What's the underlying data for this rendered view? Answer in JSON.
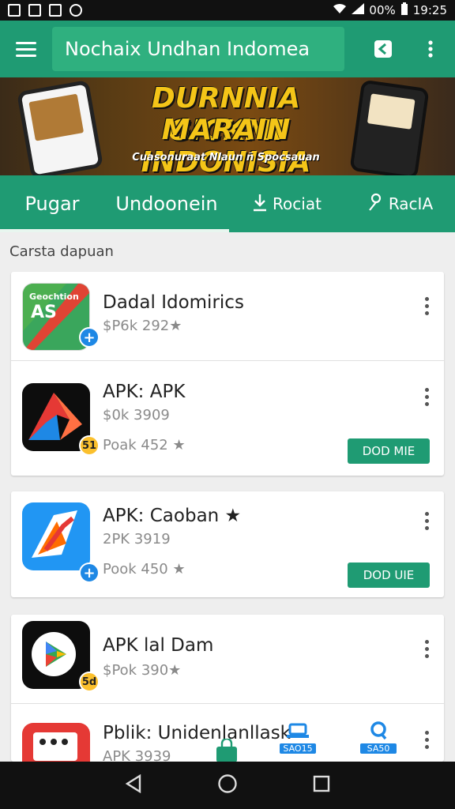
{
  "status_bar": {
    "battery": "00%",
    "time": "19:25"
  },
  "app_bar": {
    "search_text": "Nochaix Undhan Indomea"
  },
  "banner": {
    "line1": "DURNNIA GICKMI",
    "line2": "MARAIN INDONISIA",
    "tagline": "Cuasonuraat Nlaun ñ Spocsauan"
  },
  "tabs": [
    {
      "label": "Pugar"
    },
    {
      "label": "Undoonein"
    },
    {
      "label": "Rociat",
      "icon": "download-icon"
    },
    {
      "label": "RacIA",
      "icon": "person-icon"
    }
  ],
  "section": {
    "title": "Carsta dapuan"
  },
  "apps": [
    {
      "name": "Dadal Idomirics",
      "sub1": "$P6k 292★",
      "sub2": "",
      "button": "",
      "icon_label": "Geochtion\nAS",
      "badge": "+"
    },
    {
      "name": "APK: APK",
      "sub1": "$0k 3909",
      "sub2": "Poak 452 ★",
      "button": "DOD MIE",
      "badge": "51"
    },
    {
      "name": "APK: Caoban ★",
      "sub1": "2PK 3919",
      "sub2": "Pook 450 ★",
      "button": "DOD UIE",
      "badge": "+"
    },
    {
      "name": "APK lal Dam",
      "sub1": "$Pok 390★",
      "sub2": "",
      "button": "",
      "badge": "5d"
    },
    {
      "name": "Pblik: Unidenlanllask",
      "sub1": "APK 3939",
      "sub2": "",
      "button": "",
      "mini_buttons": [
        "SAO15",
        "SA50"
      ]
    }
  ],
  "colors": {
    "primary": "#1f9b73",
    "search": "#2fb07f",
    "banner_text": "#f4c518"
  },
  "nav": {
    "back": "back-icon",
    "home": "home-icon",
    "recents": "recents-icon"
  }
}
